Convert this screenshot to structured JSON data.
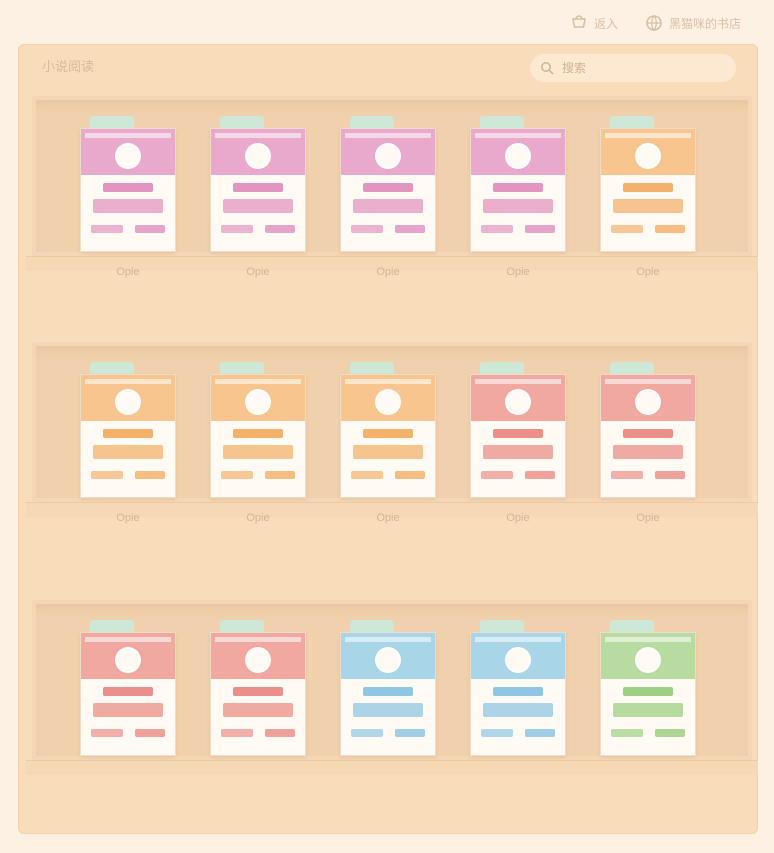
{
  "topbar": {
    "cart_label": "返入",
    "user_label": "黑猫咪的书店"
  },
  "panel": {
    "title": "小说阅读",
    "search_placeholder": "搜索"
  },
  "shelves": [
    {
      "label": "Opie",
      "cards": [
        "pink",
        "pink",
        "pink",
        "pink",
        "orange"
      ]
    },
    {
      "label": "Opie",
      "cards": [
        "orange",
        "orange",
        "orange",
        "red",
        "red"
      ]
    },
    {
      "label": "",
      "cards": [
        "red",
        "red",
        "blue",
        "blue",
        "green"
      ]
    }
  ],
  "icons": {
    "cart": "cart-icon",
    "user": "globe-icon",
    "search": "search-icon"
  },
  "colors": {
    "background": "#fdf1e4",
    "panel": "#f9dcb9",
    "pink": "#e8a9cc",
    "orange": "#f7c58d",
    "red": "#f0a8a0",
    "blue": "#a9d5e8",
    "green": "#b7dba0"
  }
}
